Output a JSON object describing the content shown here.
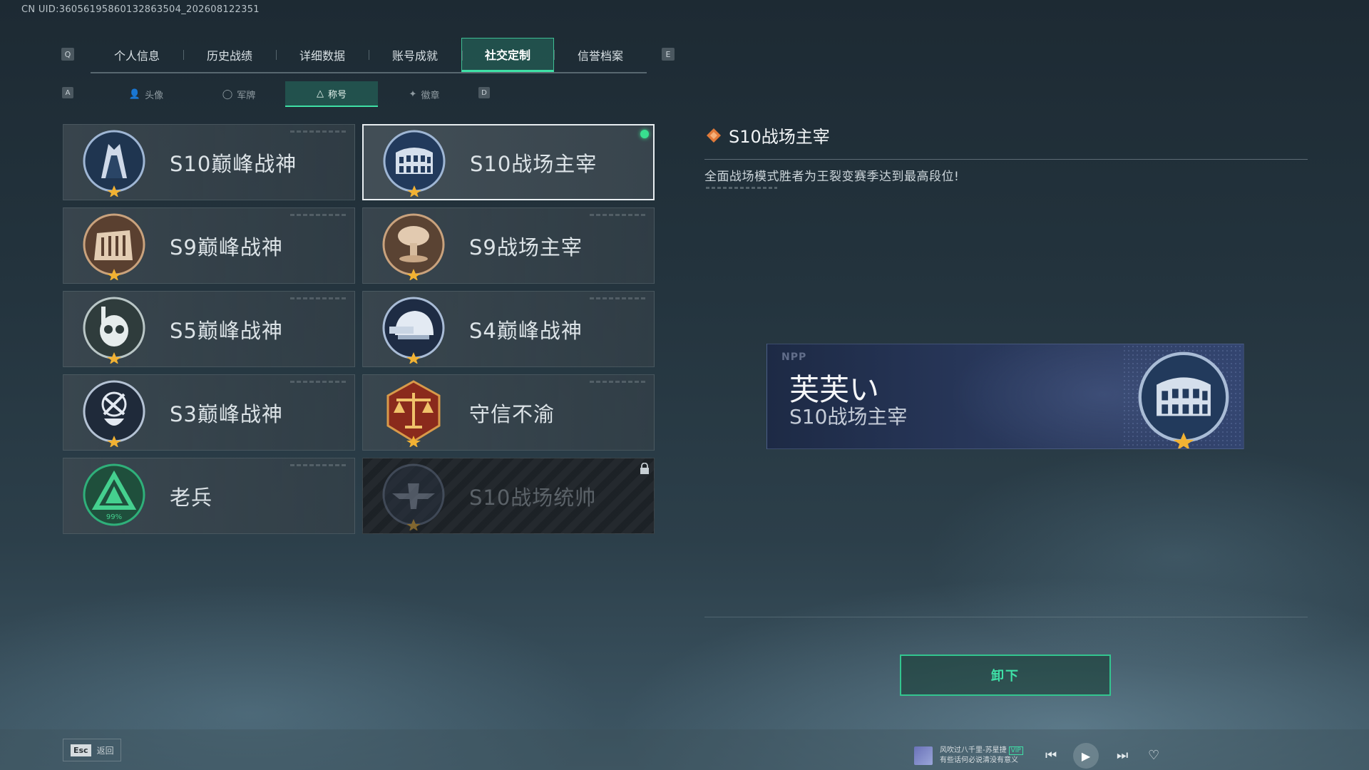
{
  "uid_text": "CN UID:3605619586013286350­4_202608122351",
  "top_tabs": {
    "prev_key": "Q",
    "next_key": "E",
    "items": [
      {
        "label": "个人信息"
      },
      {
        "label": "历史战绩"
      },
      {
        "label": "详细数据"
      },
      {
        "label": "账号成就"
      },
      {
        "label": "社交定制",
        "active": true
      },
      {
        "label": "信誉档案"
      }
    ]
  },
  "sub_tabs": {
    "prev_key": "A",
    "next_key": "D",
    "items": [
      {
        "label": "头像",
        "icon": "person-icon"
      },
      {
        "label": "军牌",
        "icon": "dogtag-icon"
      },
      {
        "label": "称号",
        "icon": "triangle-icon",
        "active": true
      },
      {
        "label": "徽章",
        "icon": "badge-icon"
      }
    ]
  },
  "titles": [
    {
      "label": "S10巅峰战神",
      "emblem": "spire-emblem"
    },
    {
      "label": "S10战场主宰",
      "emblem": "colosseum-emblem",
      "selected": true,
      "equipped": true
    },
    {
      "label": "S9巅峰战神",
      "emblem": "ruins-emblem"
    },
    {
      "label": "S9战场主宰",
      "emblem": "mushroom-cloud-emblem"
    },
    {
      "label": "S5巅峰战神",
      "emblem": "diver-skull-emblem"
    },
    {
      "label": "S4巅峰战神",
      "emblem": "helmet-emblem"
    },
    {
      "label": "S3巅峰战神",
      "emblem": "skull-globe-emblem"
    },
    {
      "label": "守信不渝",
      "emblem": "scales-emblem"
    },
    {
      "label": "老兵",
      "emblem": "veteran-triangle-emblem",
      "progress_text": "99%"
    },
    {
      "label": "S10战场统帅",
      "emblem": "aircraft-emblem",
      "locked": true
    }
  ],
  "detail": {
    "title": "S10战场主宰",
    "description": "全面战场模式胜者为王裂变赛季达到最高段位!"
  },
  "preview": {
    "logo_text": "NPP",
    "player_name": "芙芙い",
    "title": "S10战场主宰"
  },
  "unequip_label": "卸下",
  "bottom": {
    "esc_key": "Esc",
    "back_label": "返回",
    "song_line1": "风吹过八千里-苏星捷",
    "song_vip": "VIP",
    "song_line2": "有些话何必说清没有意义"
  },
  "colors": {
    "accent": "#3fe0a6",
    "equipped_dot": "#38e08f",
    "star": "#f2b233"
  }
}
